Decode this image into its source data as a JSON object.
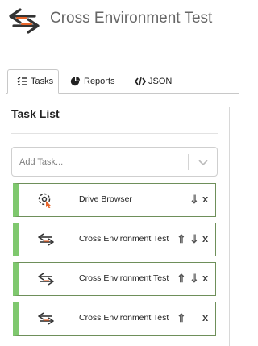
{
  "header": {
    "icon": "swap-arrows-icon",
    "title": "Cross Environment Test"
  },
  "tabs": [
    {
      "label": "Tasks",
      "icon": "list-icon",
      "active": true
    },
    {
      "label": "Reports",
      "icon": "pie-chart-icon",
      "active": false
    },
    {
      "label": "JSON",
      "icon": "code-icon",
      "active": false
    }
  ],
  "task_list": {
    "title": "Task List",
    "add_task_placeholder": "Add Task...",
    "tasks": [
      {
        "name": "Drive Browser",
        "icon": "target-cursor-icon",
        "controls": [
          "move-down",
          "remove"
        ]
      },
      {
        "name": "Cross Environment Test",
        "icon": "swap-arrows-icon",
        "controls": [
          "move-up",
          "move-down",
          "remove"
        ]
      },
      {
        "name": "Cross Environment Test",
        "icon": "swap-arrows-icon",
        "controls": [
          "move-up",
          "move-down",
          "remove"
        ]
      },
      {
        "name": "Cross Environment Test",
        "icon": "swap-arrows-icon",
        "controls": [
          "move-up",
          "remove"
        ]
      }
    ]
  },
  "controls": {
    "up": "⇑",
    "down": "⇓",
    "remove": "x"
  },
  "colors": {
    "accent_orange": "#e8652a",
    "task_stripe": "#7fc86e",
    "task_border": "#6e8f5a"
  }
}
